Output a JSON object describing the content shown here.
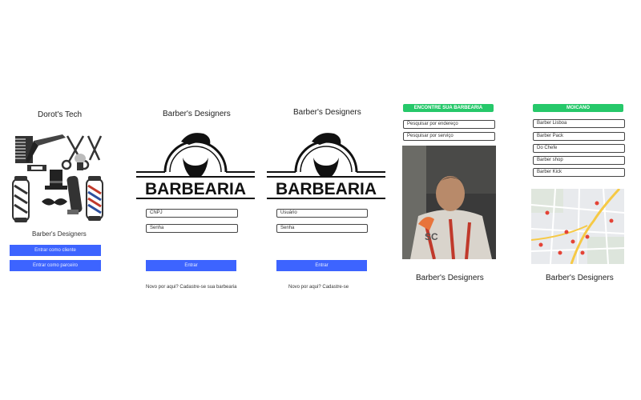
{
  "screen1": {
    "title": "Dorot's Tech",
    "subtitle": "Barber's Designers",
    "btn_client": "Entrar como cliente",
    "btn_partner": "Entrar como parceiro",
    "accent": "#3d64ff"
  },
  "screen2": {
    "title": "Barber's Designers",
    "logo_text": "BARBEARIA",
    "cnpj_placeholder": "CNPJ",
    "password_placeholder": "Senha",
    "btn_enter": "Entrar",
    "signup_text": "Novo por aqui? Cadastre-se sua barbearia"
  },
  "screen3": {
    "title": "Barber's Designers",
    "logo_text": "BARBEARIA",
    "user_placeholder": "Usuário",
    "password_placeholder": "Senha",
    "btn_enter": "Entrar",
    "signup_text": "Novo por aqui? Cadastre-se"
  },
  "screen4": {
    "header": "ENCONTRE SUA BARBEARIA",
    "search_address": "Pesquisar por endereço",
    "search_service": "Pesquisar por serviço",
    "footer": "Barber's Designers",
    "header_color": "#26c86a"
  },
  "screen5": {
    "header": "MOICANO",
    "items": [
      "Barber Lisboa",
      "Barber Pack",
      "Do Chefe",
      "Barber shop",
      "Barber Kick"
    ],
    "footer": "Barber's Designers"
  }
}
